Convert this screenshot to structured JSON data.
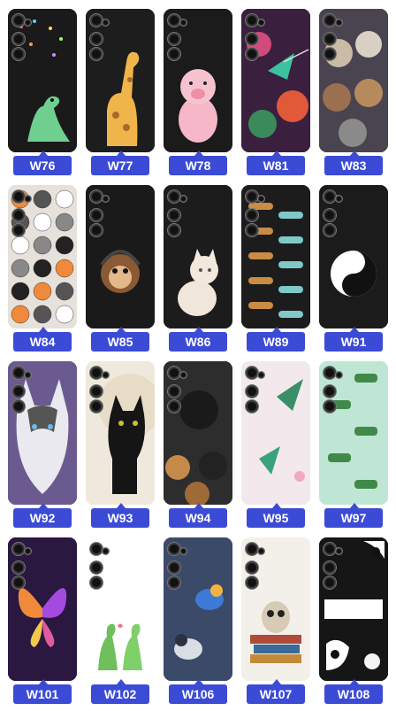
{
  "products": [
    {
      "code": "W76",
      "bg": "#1a1a1a",
      "motif": "dino-icon"
    },
    {
      "code": "W77",
      "bg": "#1d1d1d",
      "motif": "giraffe-icon"
    },
    {
      "code": "W78",
      "bg": "#1b1b1b",
      "motif": "pig-icon"
    },
    {
      "code": "W81",
      "bg": "#2a1c2d",
      "motif": "hummingbird-icon"
    },
    {
      "code": "W83",
      "bg": "#3a3440",
      "motif": "kittens-icon"
    },
    {
      "code": "W84",
      "bg": "#e6e1da",
      "motif": "cats-pattern-icon"
    },
    {
      "code": "W85",
      "bg": "#1a1a1a",
      "motif": "monkey-icon"
    },
    {
      "code": "W86",
      "bg": "#1c1c1c",
      "motif": "cat-icon"
    },
    {
      "code": "W89",
      "bg": "#1c1c1c",
      "motif": "dachshund-pattern-icon"
    },
    {
      "code": "W91",
      "bg": "#1b1b1b",
      "motif": "yin-yang-cats-icon"
    },
    {
      "code": "W92",
      "bg": "#6a5a8a",
      "motif": "husky-icon"
    },
    {
      "code": "W93",
      "bg": "#efe9dd",
      "motif": "black-cat-icon"
    },
    {
      "code": "W94",
      "bg": "#2b2b2b",
      "motif": "dogs-icon"
    },
    {
      "code": "W95",
      "bg": "#f2e6ea",
      "motif": "hummingbirds-icon"
    },
    {
      "code": "W97",
      "bg": "#bfe5d4",
      "motif": "crocodile-pattern-icon"
    },
    {
      "code": "W101",
      "bg": "#2a1840",
      "motif": "butterfly-icon"
    },
    {
      "code": "W102",
      "bg": "#ffffff",
      "motif": "dinos-pair-icon"
    },
    {
      "code": "W106",
      "bg": "#3c4a6a",
      "motif": "birds-icon"
    },
    {
      "code": "W107",
      "bg": "#f3f0ea",
      "motif": "owl-books-icon"
    },
    {
      "code": "W108",
      "bg": "#161616",
      "motif": "cow-moo-icon"
    }
  ]
}
